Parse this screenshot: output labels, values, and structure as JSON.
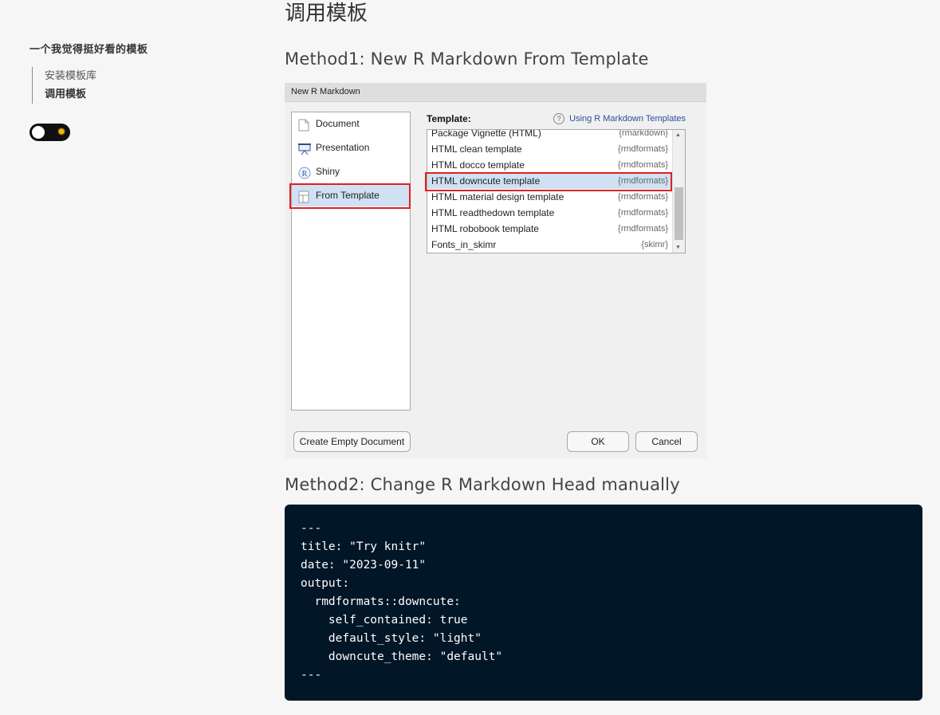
{
  "sidebar": {
    "toc_title": "一个我觉得挺好看的模板",
    "items": [
      {
        "label": "安装模板库",
        "active": false
      },
      {
        "label": "调用模板",
        "active": true
      }
    ],
    "theme_toggle": {
      "icon": "sun-icon",
      "state": "light"
    }
  },
  "main": {
    "title": "调用模板",
    "method1_heading": "Method1: New R Markdown From Template",
    "method2_heading": "Method2: Change R Markdown Head manually"
  },
  "dialog": {
    "window_title": "New R Markdown",
    "doc_types": [
      {
        "label": "Document",
        "icon": "document-icon"
      },
      {
        "label": "Presentation",
        "icon": "presentation-icon"
      },
      {
        "label": "Shiny",
        "icon": "shiny-r-icon"
      },
      {
        "label": "From Template",
        "icon": "template-icon",
        "selected": true
      }
    ],
    "template_label": "Template:",
    "help_link": "Using R Markdown Templates",
    "templates": [
      {
        "name": "Package Vignette (HTML)",
        "pkg": "{rmarkdown}"
      },
      {
        "name": "HTML clean template",
        "pkg": "{rmdformats}"
      },
      {
        "name": "HTML docco template",
        "pkg": "{rmdformats}"
      },
      {
        "name": "HTML downcute template",
        "pkg": "{rmdformats}",
        "selected": true
      },
      {
        "name": "HTML material design template",
        "pkg": "{rmdformats}"
      },
      {
        "name": "HTML readthedown template",
        "pkg": "{rmdformats}"
      },
      {
        "name": "HTML robobook template",
        "pkg": "{rmdformats}"
      },
      {
        "name": "Fonts_in_skimr",
        "pkg": "{skimr}"
      }
    ],
    "buttons": {
      "create_empty": "Create Empty Document",
      "ok": "OK",
      "cancel": "Cancel"
    }
  },
  "code_block": {
    "lines": [
      "---",
      "title: \"Try knitr\"",
      "date: \"2023-09-11\"",
      "output:",
      "  rmdformats::downcute:",
      "    self_contained: true",
      "    default_style: \"light\"",
      "    downcute_theme: \"default\"",
      "---"
    ]
  },
  "colors": {
    "page_bg": "#f6f6f6",
    "code_bg": "#011627",
    "highlight_box": "#e02020",
    "selection": "#cfe1f3"
  }
}
